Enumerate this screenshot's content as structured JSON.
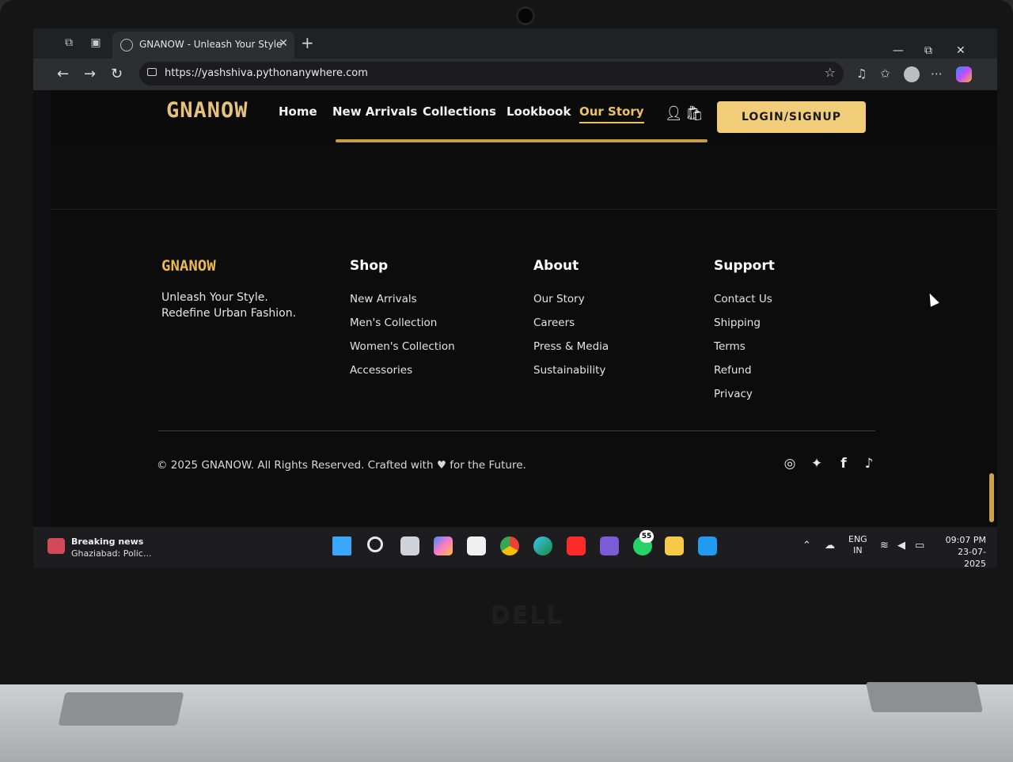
{
  "browser": {
    "tab_title": "GNANOW - Unleash Your Style",
    "url": "https://yashshiva.pythonanywhere.com"
  },
  "site": {
    "logo": "GNANOW",
    "nav": [
      "Home",
      "New Arrivals",
      "Collections",
      "Lookbook",
      "Our Story"
    ],
    "active_nav": "Our Story",
    "login_label": "LOGIN/SIGNUP"
  },
  "footer": {
    "brand": "GNANOW",
    "tagline_1": "Unleash Your Style.",
    "tagline_2": "Redefine Urban Fashion.",
    "shop": {
      "title": "Shop",
      "links": [
        "New Arrivals",
        "Men's Collection",
        "Women's Collection",
        "Accessories"
      ]
    },
    "about": {
      "title": "About",
      "links": [
        "Our Story",
        "Careers",
        "Press & Media",
        "Sustainability"
      ]
    },
    "support": {
      "title": "Support",
      "links": [
        "Contact Us",
        "Shipping",
        "Terms",
        "Refund",
        "Privacy"
      ]
    },
    "copyright": "© 2025 GNANOW. All Rights Reserved. Crafted with ♥ for the Future.",
    "social_icons": [
      "instagram-icon",
      "twitter-icon",
      "facebook-icon",
      "tiktok-icon"
    ]
  },
  "taskbar": {
    "news_title": "Breaking news",
    "news_sub": "Ghaziabad: Polic...",
    "whatsapp_badge": "55",
    "lang_1": "ENG",
    "lang_2": "IN",
    "time": "09:07 PM",
    "date": "23-07-2025"
  },
  "device": {
    "brand": "DELL"
  },
  "colors": {
    "accent": "#f0c25e",
    "button": "#f2cd79",
    "background": "#0c0c0d"
  }
}
